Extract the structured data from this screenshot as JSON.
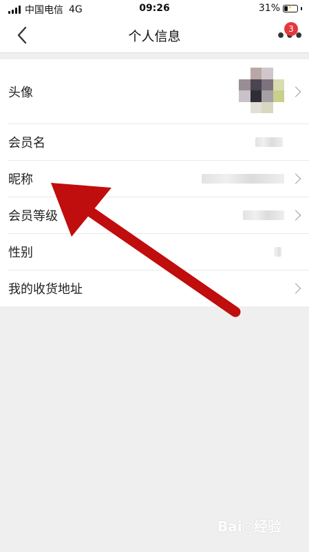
{
  "status_bar": {
    "carrier": "中国电信",
    "network": "4G",
    "time": "09:26",
    "battery": "31%",
    "battery_level": 0.31
  },
  "nav": {
    "back_icon": "chevron-left-icon",
    "title": "个人信息",
    "more_icon": "more-dots-icon",
    "badge_count": "3"
  },
  "rows": [
    {
      "label": "头像",
      "value": "",
      "has_chevron": true
    },
    {
      "label": "会员名",
      "value": "",
      "has_chevron": false
    },
    {
      "label": "昵称",
      "value": "",
      "has_chevron": true
    },
    {
      "label": "会员等级",
      "value": "",
      "has_chevron": true
    },
    {
      "label": "性别",
      "value": "",
      "has_chevron": false
    },
    {
      "label": "我的收货地址",
      "value": "",
      "has_chevron": true
    }
  ],
  "annotation": {
    "arrow_color": "#c00d0d"
  },
  "watermark": "Bai◎经验",
  "colors": {
    "badge": "#e4393c",
    "background": "#efefef"
  }
}
